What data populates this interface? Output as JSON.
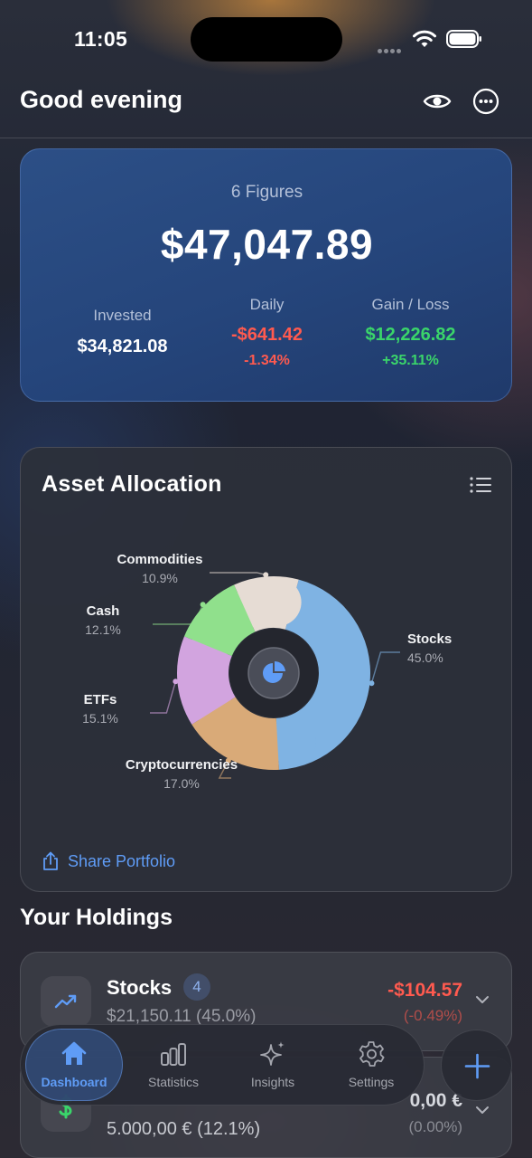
{
  "status_bar": {
    "time": "11:05"
  },
  "header": {
    "greeting": "Good evening"
  },
  "portfolio": {
    "subtitle": "6 Figures",
    "total": "$47,047.89",
    "invested_label": "Invested",
    "invested_value": "$34,821.08",
    "daily_label": "Daily",
    "daily_value": "-$641.42",
    "daily_pct": "-1.34%",
    "gain_label": "Gain / Loss",
    "gain_value": "$12,226.82",
    "gain_pct": "+35.11%"
  },
  "allocation": {
    "title": "Asset Allocation",
    "share_label": "Share Portfolio"
  },
  "chart_data": {
    "type": "pie",
    "title": "Asset Allocation",
    "slices": [
      {
        "name": "Stocks",
        "value": 45.0,
        "label": "45.0%",
        "color": "#7fb3e3"
      },
      {
        "name": "Cryptocurrencies",
        "value": 17.0,
        "label": "17.0%",
        "color": "#d9aa78"
      },
      {
        "name": "ETFs",
        "value": 15.1,
        "label": "15.1%",
        "color": "#d2a4df"
      },
      {
        "name": "Cash",
        "value": 12.1,
        "label": "12.1%",
        "color": "#90e08c"
      },
      {
        "name": "Commodities",
        "value": 10.9,
        "label": "10.9%",
        "color": "#e6dcd4"
      }
    ]
  },
  "holdings": {
    "title": "Your Holdings",
    "items": [
      {
        "name": "Stocks",
        "count": "4",
        "value": "$21,150.11 (45.0%)",
        "change": "-$104.57",
        "change_pct": "(-0.49%)"
      },
      {
        "value": "5.000,00 € (12.1%)",
        "change": "0,00 €",
        "change_pct": "(0.00%)"
      }
    ]
  },
  "tabs": [
    {
      "label": "Dashboard"
    },
    {
      "label": "Statistics"
    },
    {
      "label": "Insights"
    },
    {
      "label": "Settings"
    }
  ],
  "colors": {
    "accent": "#5f9cf6",
    "negative": "#ff5a4f",
    "positive": "#3ad56a"
  }
}
